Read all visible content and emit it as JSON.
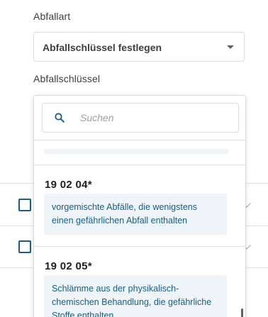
{
  "waste_type": {
    "label": "Abfallart",
    "selected_value": "Abfallschlüssel festlegen"
  },
  "waste_key": {
    "label": "Abfallschlüssel"
  },
  "search": {
    "placeholder": "Suchen",
    "value": ""
  },
  "options": [
    {
      "code": "19 02 04*",
      "description": "vorgemischte Abfälle, die wenigstens einen gefährlichen Abfall enthalten"
    },
    {
      "code": "19 02 05*",
      "description": "Schlämme aus der physikalisch-chemischen Behandlung, die gefährliche Stoffe enthalten"
    }
  ],
  "colors": {
    "accent": "#1a5e80",
    "description_background": "#eef4f8",
    "border": "#dadce0"
  },
  "icons": {
    "search": "search-icon",
    "dropdown": "caret-down-icon",
    "row_checkbox": "checkbox-icon",
    "row_expand": "chevron-down-icon"
  }
}
